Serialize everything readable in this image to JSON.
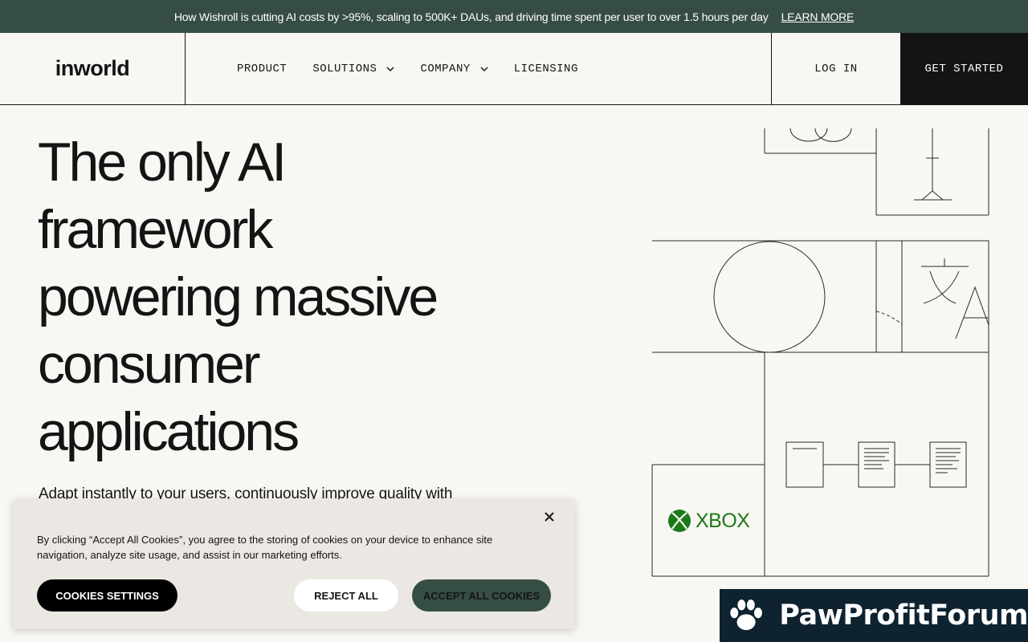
{
  "announcement": {
    "message": "How Wishroll is cutting AI costs by >95%, scaling to 500K+ DAUs, and driving time spent per user to over 1.5 hours per day",
    "link": "LEARN MORE"
  },
  "header": {
    "logo": "inworld",
    "nav": [
      {
        "label": "PRODUCT",
        "has_dropdown": false
      },
      {
        "label": "SOLUTIONS",
        "has_dropdown": true
      },
      {
        "label": "COMPANY",
        "has_dropdown": true
      },
      {
        "label": "LICENSING",
        "has_dropdown": false
      }
    ],
    "login": "LOG IN",
    "get_started": "GET STARTED"
  },
  "hero": {
    "title_lines": [
      "The only AI",
      "framework",
      "powering massive",
      "consumer",
      "applications"
    ],
    "subtitle": "Adapt instantly to your users, continuously improve quality with"
  },
  "illustration": {
    "xbox_label": "XBOX"
  },
  "cookie_banner": {
    "text": "By clicking “Accept All Cookies”, you agree to the storing of cookies on your device to enhance site navigation, analyze site usage, and assist in our marketing efforts.",
    "settings_button": "COOKIES SETTINGS",
    "reject_button": "REJECT ALL",
    "accept_button": "ACCEPT ALL COOKIES"
  },
  "watermark": {
    "text": "PawProfitForum"
  },
  "colors": {
    "accent_green": "#364d44",
    "background": "#f8f7f3",
    "ink": "#141414",
    "xbox_green": "#1a7a16",
    "watermark_bg": "#0e2230"
  }
}
